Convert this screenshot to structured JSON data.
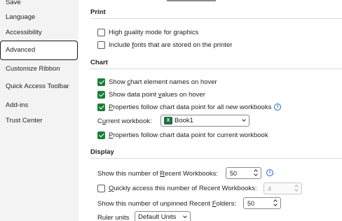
{
  "sidebar": {
    "items": [
      {
        "label": "Save"
      },
      {
        "label": "Language"
      },
      {
        "label": "Accessibility"
      },
      {
        "label": "Advanced",
        "selected": true
      },
      {
        "label": "Customize Ribbon"
      },
      {
        "label": "Quick Access Toolbar"
      },
      {
        "label": "Add-ins"
      },
      {
        "label": "Trust Center"
      }
    ]
  },
  "print": {
    "header": "Print",
    "high_quality": {
      "pre": "High ",
      "u": "q",
      "post": "uality mode for graphics",
      "checked": false
    },
    "include_fonts": {
      "pre": "Include ",
      "u": "f",
      "post": "onts that are stored on the printer",
      "checked": false
    }
  },
  "chart": {
    "header": "Chart",
    "show_names": {
      "pre": "Show ",
      "u": "c",
      "post": "hart element names on hover",
      "checked": true
    },
    "show_values": {
      "pre": "Show data point ",
      "u": "v",
      "post": "alues on hover",
      "checked": true
    },
    "props_all": {
      "pre": "",
      "u": "P",
      "post": "roperties follow chart data point for all new workbooks",
      "checked": true
    },
    "current_workbook": {
      "pre": "C",
      "u": "u",
      "post": "rrent workbook:",
      "value": "Book1",
      "icon": "X"
    },
    "props_current": {
      "pre": "",
      "u": "P",
      "post": "roperties follow chart data point for current workbook",
      "checked": true
    }
  },
  "display": {
    "header": "Display",
    "recent_workbooks": {
      "pre": "Show this number of ",
      "u": "R",
      "post": "ecent Workbooks:",
      "value": "50"
    },
    "quick_access": {
      "pre": "",
      "u": "Q",
      "post": "uickly access this number of Recent Workbooks:",
      "value": "4",
      "checked": false
    },
    "recent_folders": {
      "pre": "Show this number of unpinned Recent ",
      "u": "F",
      "post": "olders:",
      "value": "50"
    },
    "ruler_units": {
      "label": "Ruler units",
      "value": "Default Units"
    }
  },
  "icons": {
    "info": "i",
    "info_color": "#1d63d8",
    "check_color": "#1a7f37",
    "excel_color": "#1d6f42"
  }
}
